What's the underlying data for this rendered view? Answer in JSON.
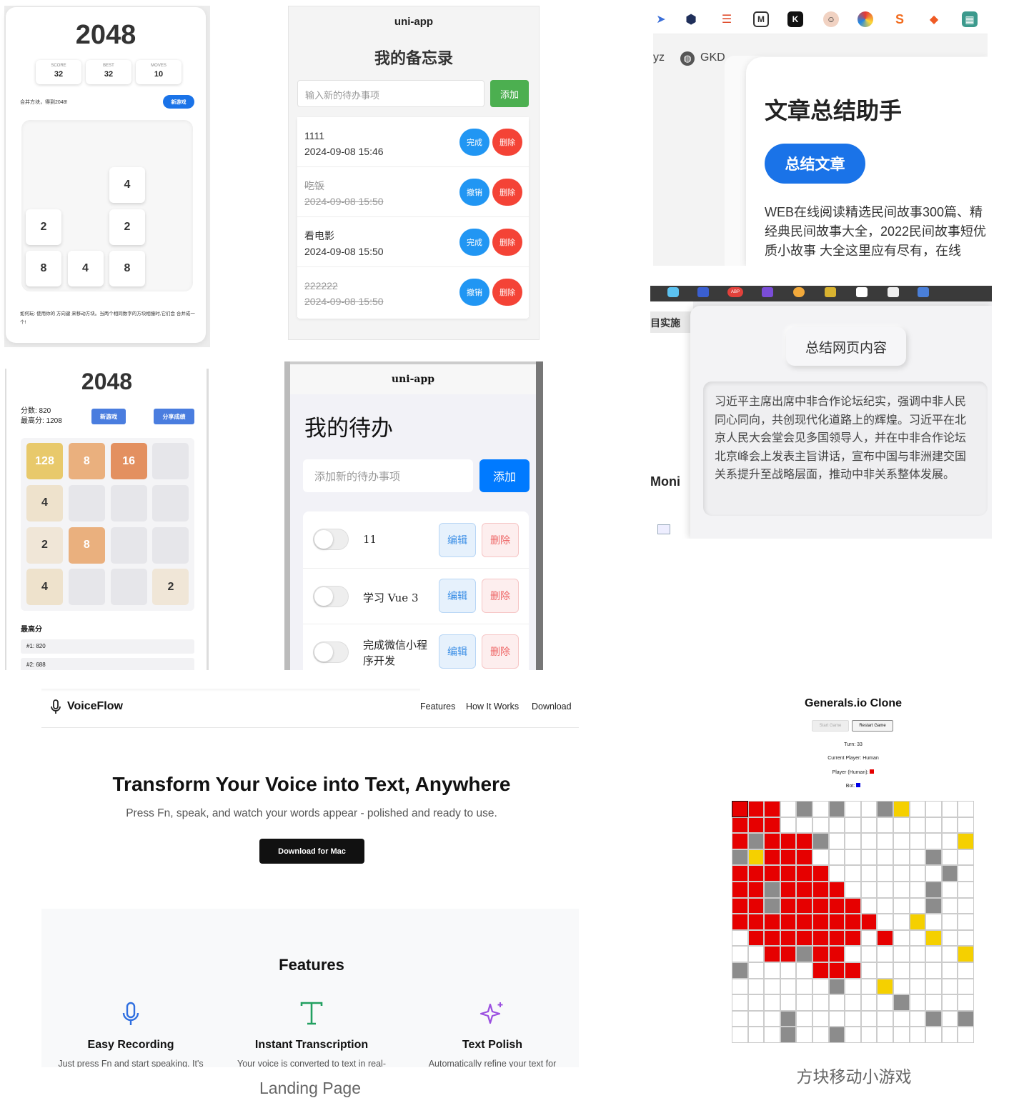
{
  "panel_2048_a": {
    "title": "2048",
    "stats": [
      {
        "label": "SCORE",
        "value": "32"
      },
      {
        "label": "BEST",
        "value": "32"
      },
      {
        "label": "MOVES",
        "value": "10"
      }
    ],
    "subtitle": "合并方块，得到2048!",
    "new_game_label": "新游戏",
    "tiles": [
      {
        "row": 1,
        "col": 2,
        "value": "4"
      },
      {
        "row": 2,
        "col": 0,
        "value": "2"
      },
      {
        "row": 2,
        "col": 2,
        "value": "2"
      },
      {
        "row": 3,
        "col": 0,
        "value": "8"
      },
      {
        "row": 3,
        "col": 1,
        "value": "4"
      },
      {
        "row": 3,
        "col": 2,
        "value": "8"
      }
    ],
    "how_to": "如何玩: 使用你的 方向键 来移动方块。当两个相同数字的方块相撞时,它们会 合并成一个!"
  },
  "panel_memo": {
    "app_title": "uni-app",
    "heading": "我的备忘录",
    "input_placeholder": "输入新的待办事项",
    "add_label": "添加",
    "items": [
      {
        "text": "1111",
        "time": "2024-09-08 15:46",
        "done": false,
        "action": "完成",
        "delete": "删除"
      },
      {
        "text": "吃饭",
        "time": "2024-09-08 15:50",
        "done": true,
        "action": "撤销",
        "delete": "删除"
      },
      {
        "text": "看电影",
        "time": "2024-09-08 15:50",
        "done": false,
        "action": "完成",
        "delete": "删除"
      },
      {
        "text": "222222",
        "time": "2024-09-08 15:50",
        "done": true,
        "action": "撤销",
        "delete": "删除"
      }
    ]
  },
  "panel_summary_a": {
    "tab_fragment": "yz",
    "tab_gkd": "GKD",
    "heading": "文章总结助手",
    "button_label": "总结文章",
    "body_text": "WEB在线阅读精选民间故事300篇、精经典民间故事大全，2022民间故事短优质小故事 大全这里应有尽有，在线",
    "toolbar_icons": [
      "bird-icon",
      "shield-icon",
      "lines-icon",
      "m-icon",
      "k-icon",
      "avatar-icon",
      "color-icon",
      "s-icon",
      "diamond-icon",
      "grid-icon"
    ],
    "colors": {
      "accent": "#1a73e8"
    }
  },
  "panel_summary_b": {
    "side_label": "目实施",
    "side_fragment": "Moni",
    "button_label": "总结网页内容",
    "summary_text": "习近平主席出席中非合作论坛纪实，强调中非人民同心同向，共创现代化道路上的辉煌。习近平在北京人民大会堂会见多国领导人，并在中非合作论坛北京峰会上发表主旨讲话，宣布中国与非洲建交国关系提升至战略层面，推动中非关系整体发展。",
    "badge": "ABP"
  },
  "panel_2048_b": {
    "title": "2048",
    "score_label": "分数: 820",
    "best_label": "最高分: 1208",
    "new_game_label": "新游戏",
    "share_label": "分享成绩",
    "tiles": [
      [
        "128",
        "8",
        "16",
        ""
      ],
      [
        "4",
        "",
        "",
        ""
      ],
      [
        "2",
        "8",
        "",
        ""
      ],
      [
        "4",
        "",
        "",
        "2"
      ]
    ],
    "highscore_heading": "最高分",
    "highscores": [
      "#1: 820",
      "#2: 688"
    ]
  },
  "panel_todo": {
    "app_title": "uni-app",
    "heading": "我的待办",
    "input_placeholder": "添加新的待办事项",
    "add_label": "添加",
    "items": [
      {
        "text": "11",
        "edit": "编辑",
        "delete": "删除"
      },
      {
        "text": "学习 Vue 3",
        "edit": "编辑",
        "delete": "删除"
      },
      {
        "text": "完成微信小程序开发",
        "edit": "编辑",
        "delete": "删除"
      }
    ]
  },
  "panel_landing": {
    "brand": "VoiceFlow",
    "nav": [
      "Features",
      "How It Works",
      "Download"
    ],
    "hero_title": "Transform Your Voice into Text, Anywhere",
    "hero_subtitle": "Press Fn, speak, and watch your words appear - polished and ready to use.",
    "cta_label": "Download for Mac",
    "features_heading": "Features",
    "features": [
      {
        "icon": "microphone-icon",
        "title": "Easy Recording",
        "desc": "Just press Fn and start speaking. It's"
      },
      {
        "icon": "text-t-icon",
        "title": "Instant Transcription",
        "desc": "Your voice is converted to text in real-"
      },
      {
        "icon": "sparkle-icon",
        "title": "Text Polish",
        "desc": "Automatically refine your text for"
      }
    ],
    "caption": "Landing Page"
  },
  "panel_generals": {
    "title": "Generals.io Clone",
    "start_label": "Start Game",
    "restart_label": "Restart Game",
    "turn": "Turn: 33",
    "current_player": "Current Player: Human",
    "player_human": "Player (Human):",
    "bot": "Bot:",
    "caption": "方块移动小游戏",
    "colors": {
      "human": "#e60000",
      "bot": "#0000e6",
      "neutral": "#f5d000",
      "mountain": "#8c8c8c"
    }
  }
}
